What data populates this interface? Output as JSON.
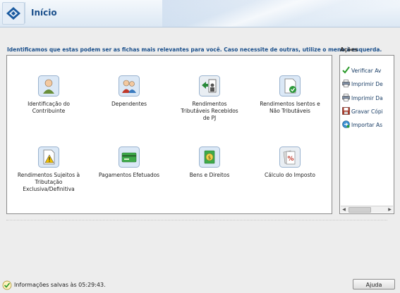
{
  "header": {
    "title": "Início"
  },
  "main": {
    "instruction": "Identificamos que estas podem ser as fichas mais relevantes para você. Caso necessite de outras, utilize o menu à esquerda.",
    "tiles": [
      {
        "label_lines": [
          "Identificação do",
          "Contribuinte"
        ],
        "icon": "person-icon"
      },
      {
        "label_lines": [
          "Dependentes"
        ],
        "icon": "dependents-icon"
      },
      {
        "label_lines": [
          "Rendimentos",
          "Tributáveis Recebidos",
          "de PJ"
        ],
        "icon": "income-pj-icon"
      },
      {
        "label_lines": [
          "Rendimentos Isentos e",
          "Não Tributáveis"
        ],
        "icon": "exempt-income-icon"
      },
      {
        "label_lines": [
          "Rendimentos Sujeitos à",
          "Tributação",
          "Exclusiva/Definitiva"
        ],
        "icon": "exclusive-taxation-icon"
      },
      {
        "label_lines": [
          "Pagamentos Efetuados"
        ],
        "icon": "payments-icon"
      },
      {
        "label_lines": [
          "Bens e Direitos"
        ],
        "icon": "assets-icon"
      },
      {
        "label_lines": [
          "Cálculo do Imposto"
        ],
        "icon": "tax-calc-icon"
      }
    ]
  },
  "actions": {
    "title": "Ações",
    "items": [
      {
        "label": "Verificar Av",
        "icon": "checkmark-icon"
      },
      {
        "label": "Imprimir De",
        "icon": "printer-icon"
      },
      {
        "label": "Imprimir Da",
        "icon": "printer-icon"
      },
      {
        "label": "Gravar Cópi",
        "icon": "save-copy-icon"
      },
      {
        "label": "Importar As",
        "icon": "import-icon"
      }
    ]
  },
  "status": {
    "text": "Informações salvas às 05:29:43."
  },
  "help_button": {
    "label": "Ajuda"
  }
}
